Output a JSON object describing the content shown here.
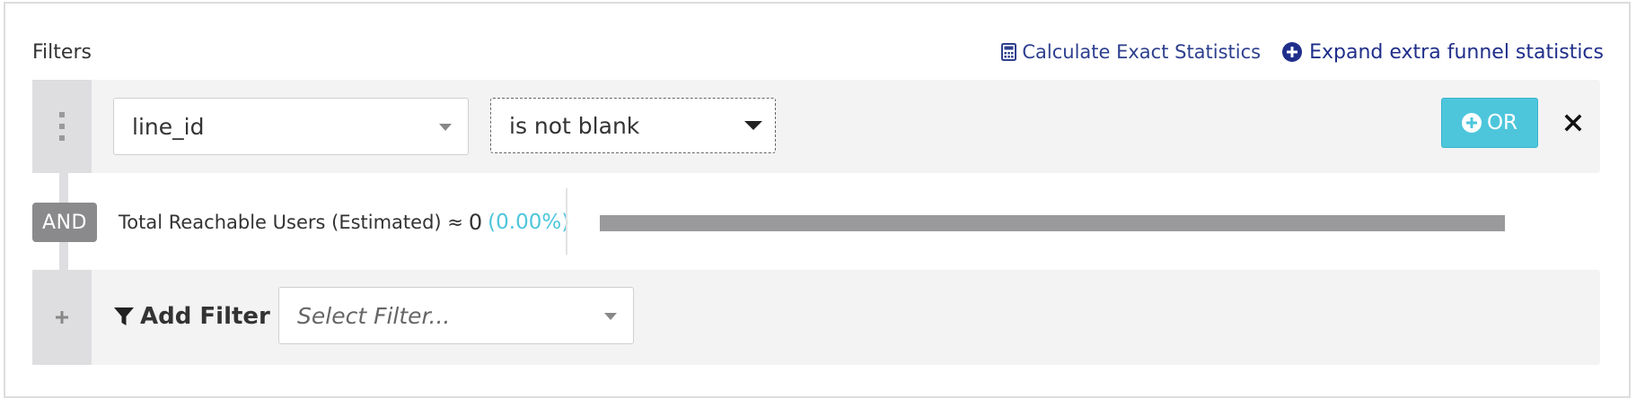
{
  "header": {
    "title": "Filters",
    "calc_label": "Calculate Exact Statistics",
    "expand_label": "Expand extra funnel statistics"
  },
  "filter": {
    "field_value": "line_id",
    "operator_value": "is not blank",
    "or_label": "OR"
  },
  "reach": {
    "connector_label": "AND",
    "label": "Total Reachable Users (Estimated) ≈",
    "count": "0",
    "percent": "(0.00%)",
    "bar_fill_fraction": 1.0
  },
  "add_filter": {
    "label": "Add Filter",
    "placeholder": "Select Filter..."
  },
  "colors": {
    "accent": "#4dc6dc",
    "link": "#2d3f8f",
    "and_badge": "#8a8a8c",
    "bar_fill": "#9a9a9c"
  }
}
